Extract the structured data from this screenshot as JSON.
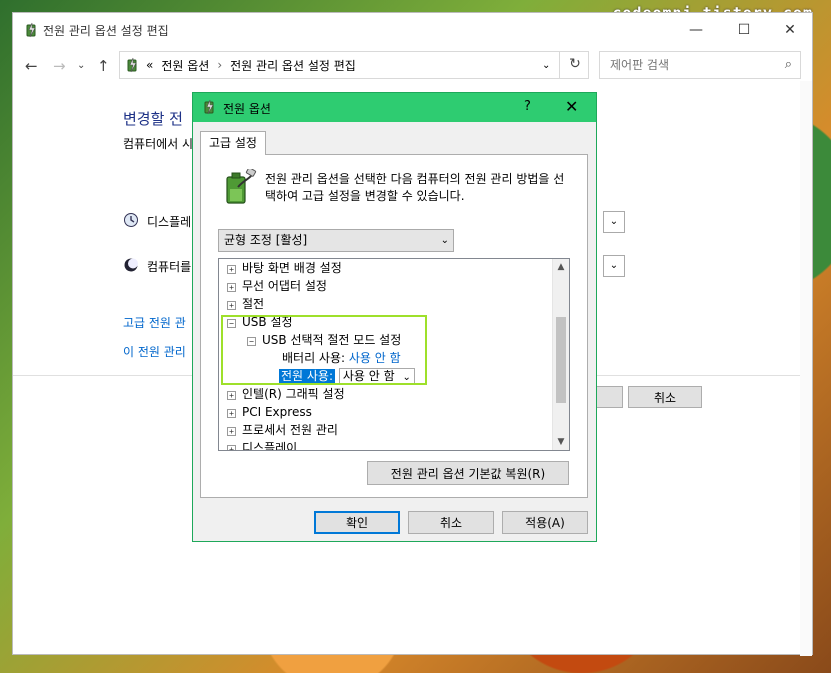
{
  "watermark": "codeomni.tistory.com",
  "window": {
    "title": "전원 관리 옵션 설정 편집",
    "minimize": "—",
    "maximize": "☐",
    "close": "✕"
  },
  "nav": {
    "back": "←",
    "forward": "→",
    "up": "↑",
    "recent": "⌄"
  },
  "address": {
    "chevrons": "«",
    "crumb1": "전원 옵션",
    "sep": "›",
    "crumb2": "전원 관리 옵션 설정 편집",
    "dropdown": "⌄",
    "refresh": "↻"
  },
  "search": {
    "placeholder": "제어판 검색",
    "icon": "⌕"
  },
  "background": {
    "heading": "변경할 전",
    "subtext": "컴퓨터에서 시",
    "row1": "디스플레이",
    "row2": "컴퓨터를",
    "link1": "고급 전원 관",
    "link2": "이 전원 관리",
    "cancel": "취소"
  },
  "dialog": {
    "title": "전원 옵션",
    "help": "?",
    "close": "✕",
    "tab": "고급 설정",
    "description": "전원 관리 옵션을 선택한 다음 컴퓨터의 전원 관리 방법을 선택하여 고급 설정을 변경할 수 있습니다.",
    "plan": "균형 조정 [활성]",
    "tree": [
      {
        "toggle": "+",
        "label": "바탕 화면 배경 설정"
      },
      {
        "toggle": "+",
        "label": "무선 어댑터 설정"
      },
      {
        "toggle": "+",
        "label": "절전"
      },
      {
        "toggle": "−",
        "label": "USB 설정"
      },
      {
        "toggle": "−",
        "label": "USB 선택적 절전 모드 설정"
      },
      {
        "label": "배터리 사용:",
        "value": "사용 안 함"
      },
      {
        "label": "전원 사용:",
        "value": "사용 안 함"
      },
      {
        "toggle": "+",
        "label": "인텔(R) 그래픽 설정"
      },
      {
        "toggle": "+",
        "label": "PCI Express"
      },
      {
        "toggle": "+",
        "label": "프로세서 전원 관리"
      },
      {
        "toggle": "+",
        "label": "디스플레이"
      }
    ],
    "restore": "전원 관리 옵션 기본값 복원(R)",
    "ok": "확인",
    "cancel": "취소",
    "apply": "적용(A)"
  }
}
